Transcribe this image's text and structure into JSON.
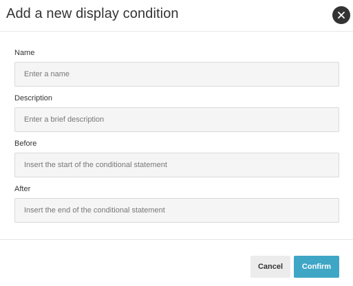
{
  "dialog": {
    "title": "Add a new display condition",
    "close_icon": "close-icon"
  },
  "fields": {
    "name": {
      "label": "Name",
      "value": "",
      "placeholder": "Enter a name"
    },
    "description": {
      "label": "Description",
      "value": "",
      "placeholder": "Enter a brief description"
    },
    "before": {
      "label": "Before",
      "value": "",
      "placeholder": "Insert the start of the conditional statement"
    },
    "after": {
      "label": "After",
      "value": "",
      "placeholder": "Insert the end of the conditional statement"
    }
  },
  "footer": {
    "cancel_label": "Cancel",
    "confirm_label": "Confirm"
  },
  "colors": {
    "confirm_accent": "#3fa6c6",
    "close_button_bg": "#333333"
  }
}
